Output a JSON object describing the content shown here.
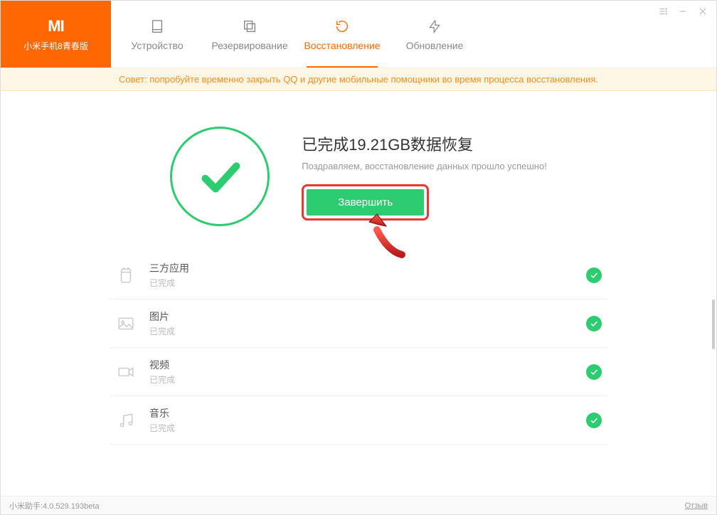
{
  "brand": {
    "logo": "MI",
    "device": "小米手机8青春版"
  },
  "tabs": {
    "device": "Устройство",
    "backup": "Резервирование",
    "restore": "Восстановление",
    "update": "Обновление"
  },
  "tip": "Совет: попробуйте временно закрыть QQ и другие мобильные помощники во время процесса восстановления.",
  "success": {
    "title": "已完成19.21GB数据恢复",
    "subtitle": "Поздравляем, восстановление данных прошло успешно!",
    "button": "Завершить"
  },
  "items": [
    {
      "title": "三方应用",
      "sub": "已完成",
      "icon": "apps"
    },
    {
      "title": "图片",
      "sub": "已完成",
      "icon": "image"
    },
    {
      "title": "视频",
      "sub": "已完成",
      "icon": "video"
    },
    {
      "title": "音乐",
      "sub": "已完成",
      "icon": "music"
    }
  ],
  "footer": {
    "version": "小米助手:4.0.529.193beta",
    "feedback": "Отзыв"
  }
}
